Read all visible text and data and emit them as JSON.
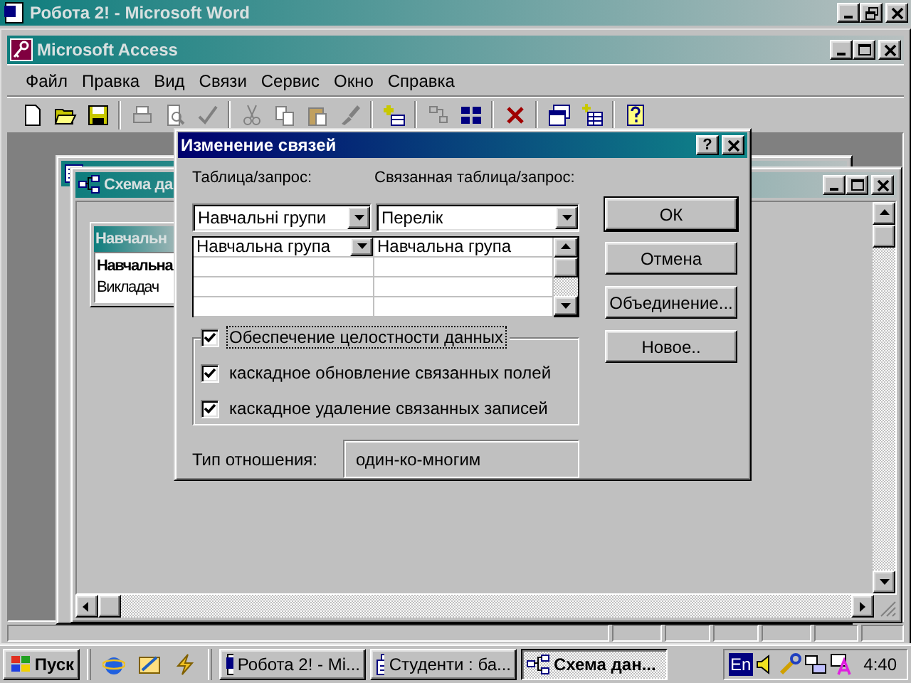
{
  "word_window": {
    "title": "Робота 2! - Microsoft Word"
  },
  "access_window": {
    "title": "Microsoft Access",
    "menu": [
      {
        "label": "Файл"
      },
      {
        "label": "Правка"
      },
      {
        "label": "Вид"
      },
      {
        "label": "Связи"
      },
      {
        "label": "Сервис"
      },
      {
        "label": "Окно"
      },
      {
        "label": "Справка"
      }
    ],
    "toolbar": [
      {
        "kind": "new",
        "disabled": false
      },
      {
        "kind": "open",
        "disabled": false
      },
      {
        "kind": "save",
        "disabled": false
      },
      {
        "kind": "sep"
      },
      {
        "kind": "print",
        "disabled": true
      },
      {
        "kind": "preview",
        "disabled": true
      },
      {
        "kind": "spell",
        "disabled": true
      },
      {
        "kind": "sep"
      },
      {
        "kind": "cut",
        "disabled": true
      },
      {
        "kind": "copy",
        "disabled": true
      },
      {
        "kind": "paste",
        "disabled": true
      },
      {
        "kind": "brush",
        "disabled": true
      },
      {
        "kind": "sep"
      },
      {
        "kind": "addtable",
        "disabled": false
      },
      {
        "kind": "sep"
      },
      {
        "kind": "direct",
        "disabled": true
      },
      {
        "kind": "allrel",
        "disabled": false
      },
      {
        "kind": "sep"
      },
      {
        "kind": "delete",
        "disabled": false
      },
      {
        "kind": "sep"
      },
      {
        "kind": "window",
        "disabled": false
      },
      {
        "kind": "newobject",
        "disabled": false
      },
      {
        "kind": "sep"
      },
      {
        "kind": "help",
        "disabled": false
      }
    ]
  },
  "schema_window": {
    "title": "Схема да",
    "table": {
      "title": "Навчальн",
      "fields": [
        {
          "label": "Навчальна",
          "key": true
        },
        {
          "label": "Викладач",
          "key": false
        }
      ]
    }
  },
  "dialog": {
    "title": "Изменение связей",
    "help_button": "?",
    "table_label": "Таблица/запрос:",
    "related_label": "Связанная таблица/запрос:",
    "table_value": "Навчальні групи",
    "related_value": "Перелік",
    "field_rows": [
      {
        "field": "Навчальна група",
        "related_field": "Навчальна група"
      }
    ],
    "options": [
      {
        "label": "Обеспечение целостности данных",
        "checked": true,
        "focused": true
      },
      {
        "label": "каскадное обновление связанных полей",
        "checked": true,
        "focused": false
      },
      {
        "label": "каскадное удаление связанных записей",
        "checked": true,
        "focused": false
      }
    ],
    "relation_label": "Тип отношения:",
    "relation_value": "один-ко-многим",
    "buttons": [
      {
        "label": "ОК",
        "default": true
      },
      {
        "label": "Отмена",
        "default": false
      },
      {
        "label": "Объединение...",
        "default": false
      },
      {
        "label": "Новое..",
        "default": false
      }
    ]
  },
  "taskbar": {
    "start": "Пуск",
    "tasks": [
      {
        "kind": "word",
        "label": "Робота 2! - Mi...",
        "selected": false
      },
      {
        "kind": "form",
        "label": "Студенти : ба...",
        "selected": false
      },
      {
        "kind": "schema",
        "label": "Схема дан...",
        "selected": true
      }
    ],
    "language": "En",
    "clock": "4:40"
  }
}
